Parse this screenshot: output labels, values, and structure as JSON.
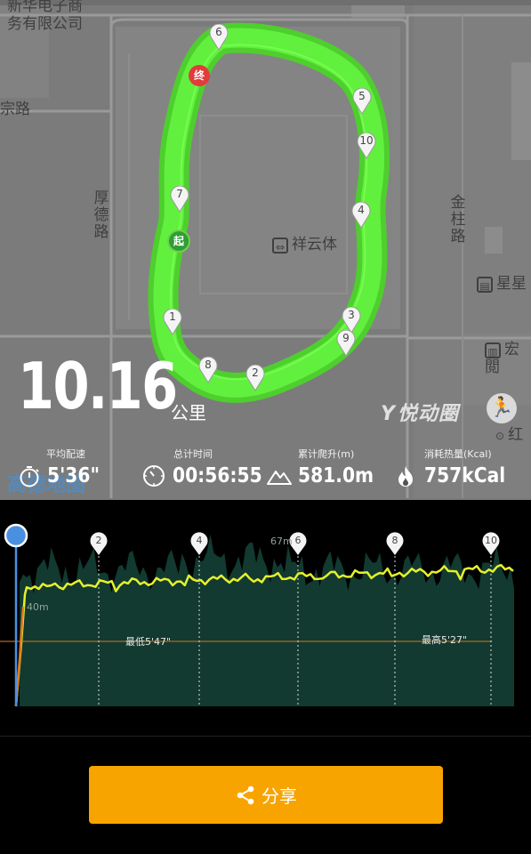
{
  "map": {
    "labels": {
      "company_line1": "新华电子商",
      "company_line2": "务有限公司",
      "road_left": "宗路",
      "road_houde": "厚德路",
      "road_jinzhu": "金柱路",
      "poi_xiangyun": "祥云体",
      "poi_xingxing": "星星",
      "poi_hongcheng": "宏閲",
      "poi_hong": "红",
      "watermark": "高德地图"
    },
    "start_label": "起",
    "end_label": "终",
    "km_markers": [
      "1",
      "2",
      "3",
      "4",
      "5",
      "6",
      "7",
      "8",
      "9",
      "10"
    ],
    "route_color": "#5af03c"
  },
  "summary": {
    "distance": "10.16",
    "distance_unit": "公里",
    "brand": "悦动圈"
  },
  "stats": [
    {
      "caption": "平均配速",
      "value": "5'36\"",
      "icon": "stopwatch-icon"
    },
    {
      "caption": "总计时间",
      "value": "00:56:55",
      "icon": "clock-icon"
    },
    {
      "caption": "累计爬升(m)",
      "value": "581.0m",
      "icon": "mountain-icon"
    },
    {
      "caption": "消耗热量(Kcal)",
      "value": "757kCal",
      "icon": "flame-icon"
    }
  ],
  "chart": {
    "km_markers": [
      "2",
      "4",
      "6",
      "8",
      "10"
    ],
    "elev_top_label": "67m",
    "elev_bottom_label": "40m",
    "min_pace_label": "最低5'47\"",
    "max_pace_label": "最高5'27\"",
    "colors": {
      "pace_line": "#e6f02a",
      "elevation_fill": "#123a30",
      "ref_line": "#b06a1a",
      "progress": "#4a90e2"
    }
  },
  "share": {
    "label": "分享"
  }
}
